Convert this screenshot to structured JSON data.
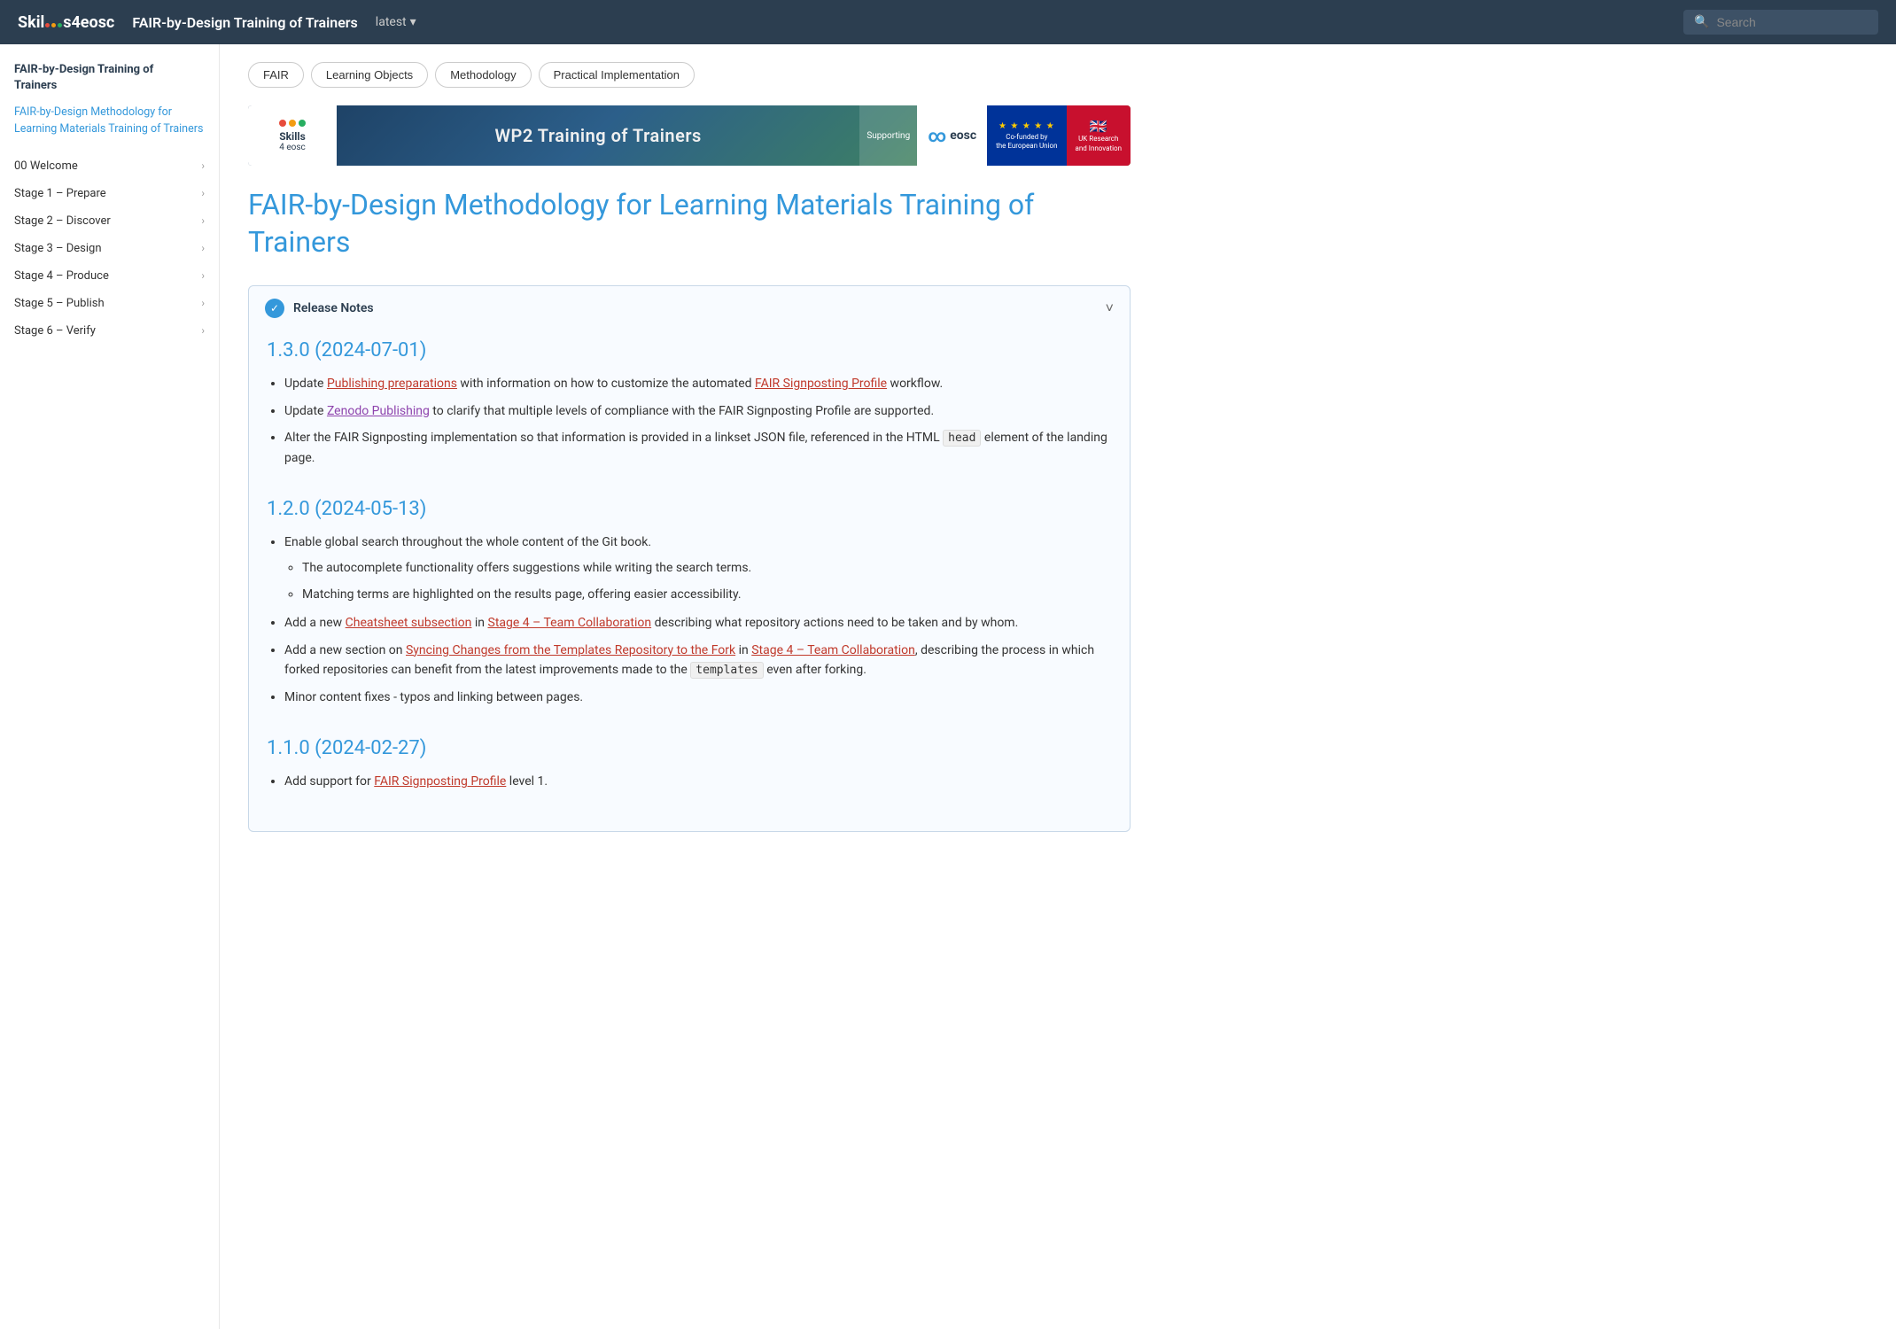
{
  "header": {
    "logo": {
      "prefix": "Skil",
      "suffix": "s4eosc"
    },
    "title": "FAIR-by-Design Training of Trainers",
    "version": "latest",
    "search_placeholder": "Search"
  },
  "tabs": [
    {
      "id": "fair",
      "label": "FAIR"
    },
    {
      "id": "learning-objects",
      "label": "Learning Objects"
    },
    {
      "id": "methodology",
      "label": "Methodology"
    },
    {
      "id": "practical-implementation",
      "label": "Practical Implementation"
    }
  ],
  "banner": {
    "logo_text": "Skills",
    "logo_sub": "4 eosc",
    "title": "WP2 Training of Trainers",
    "support_label": "Supporting",
    "eosc_label": "eosc",
    "eu_label": "Co-funded by\nthe European Union",
    "uk_label": "UK Research\nand Innovation"
  },
  "sidebar": {
    "book_title": "FAIR-by-Design Training of\nTrainers",
    "active_link": "FAIR-by-Design Methodology for Learning Materials Training of Trainers",
    "nav_items": [
      {
        "id": "welcome",
        "label": "00 Welcome"
      },
      {
        "id": "stage1",
        "label": "Stage 1 – Prepare"
      },
      {
        "id": "stage2",
        "label": "Stage 2 – Discover"
      },
      {
        "id": "stage3",
        "label": "Stage 3 – Design"
      },
      {
        "id": "stage4",
        "label": "Stage 4 – Produce"
      },
      {
        "id": "stage5",
        "label": "Stage 5 – Publish"
      },
      {
        "id": "stage6",
        "label": "Stage 6 – Verify"
      }
    ]
  },
  "page": {
    "heading": "FAIR-by-Design Methodology for Learning Materials Training of Trainers",
    "release_notes_label": "Release Notes",
    "versions": [
      {
        "id": "v130",
        "title": "1.3.0 (2024-07-01)",
        "bullets": [
          {
            "text_parts": [
              {
                "type": "text",
                "content": "Update "
              },
              {
                "type": "link",
                "content": "Publishing preparations",
                "style": "red"
              },
              {
                "type": "text",
                "content": " with information on how to customize the automated "
              },
              {
                "type": "link",
                "content": "FAIR Signposting Profile",
                "style": "red"
              },
              {
                "type": "text",
                "content": " workflow."
              }
            ]
          },
          {
            "text_parts": [
              {
                "type": "text",
                "content": "Update "
              },
              {
                "type": "link",
                "content": "Zenodo Publishing",
                "style": "purple"
              },
              {
                "type": "text",
                "content": " to clarify that multiple levels of compliance with the FAIR Signposting Profile are supported."
              }
            ]
          },
          {
            "text_parts": [
              {
                "type": "text",
                "content": "Alter the FAIR Signposting implementation so that information is provided in a linkset JSON file, referenced in the HTML "
              },
              {
                "type": "code",
                "content": "head"
              },
              {
                "type": "text",
                "content": " element of the landing page."
              }
            ]
          }
        ]
      },
      {
        "id": "v120",
        "title": "1.2.0 (2024-05-13)",
        "bullets": [
          {
            "text_parts": [
              {
                "type": "text",
                "content": "Enable global search throughout the whole content of the Git book."
              }
            ],
            "sub_bullets": [
              {
                "text": "The autocomplete functionality offers suggestions while writing the search terms."
              },
              {
                "text": "Matching terms are highlighted on the results page, offering easier accessibility."
              }
            ]
          },
          {
            "text_parts": [
              {
                "type": "text",
                "content": "Add a new "
              },
              {
                "type": "link",
                "content": "Cheatsheet subsection",
                "style": "red"
              },
              {
                "type": "text",
                "content": " in "
              },
              {
                "type": "link",
                "content": "Stage 4 – Team Collaboration",
                "style": "red"
              },
              {
                "type": "text",
                "content": " describing what repository actions need to be taken and by whom."
              }
            ]
          },
          {
            "text_parts": [
              {
                "type": "text",
                "content": "Add a new section on "
              },
              {
                "type": "link",
                "content": "Syncing Changes from the Templates Repository to the Fork",
                "style": "red"
              },
              {
                "type": "text",
                "content": " in "
              },
              {
                "type": "link",
                "content": "Stage 4 – Team Collaboration",
                "style": "red"
              },
              {
                "type": "text",
                "content": ", describing the process in which forked repositories can benefit from the latest improvements made to the "
              },
              {
                "type": "code",
                "content": "templates"
              },
              {
                "type": "text",
                "content": " even after forking."
              }
            ]
          },
          {
            "text_parts": [
              {
                "type": "text",
                "content": "Minor content fixes - typos and linking between pages."
              }
            ]
          }
        ]
      },
      {
        "id": "v110",
        "title": "1.1.0 (2024-02-27)",
        "bullets": [
          {
            "text_parts": [
              {
                "type": "text",
                "content": "Add support for "
              },
              {
                "type": "link",
                "content": "FAIR Signposting Profile",
                "style": "red"
              },
              {
                "type": "text",
                "content": " level 1."
              }
            ]
          }
        ]
      }
    ]
  }
}
